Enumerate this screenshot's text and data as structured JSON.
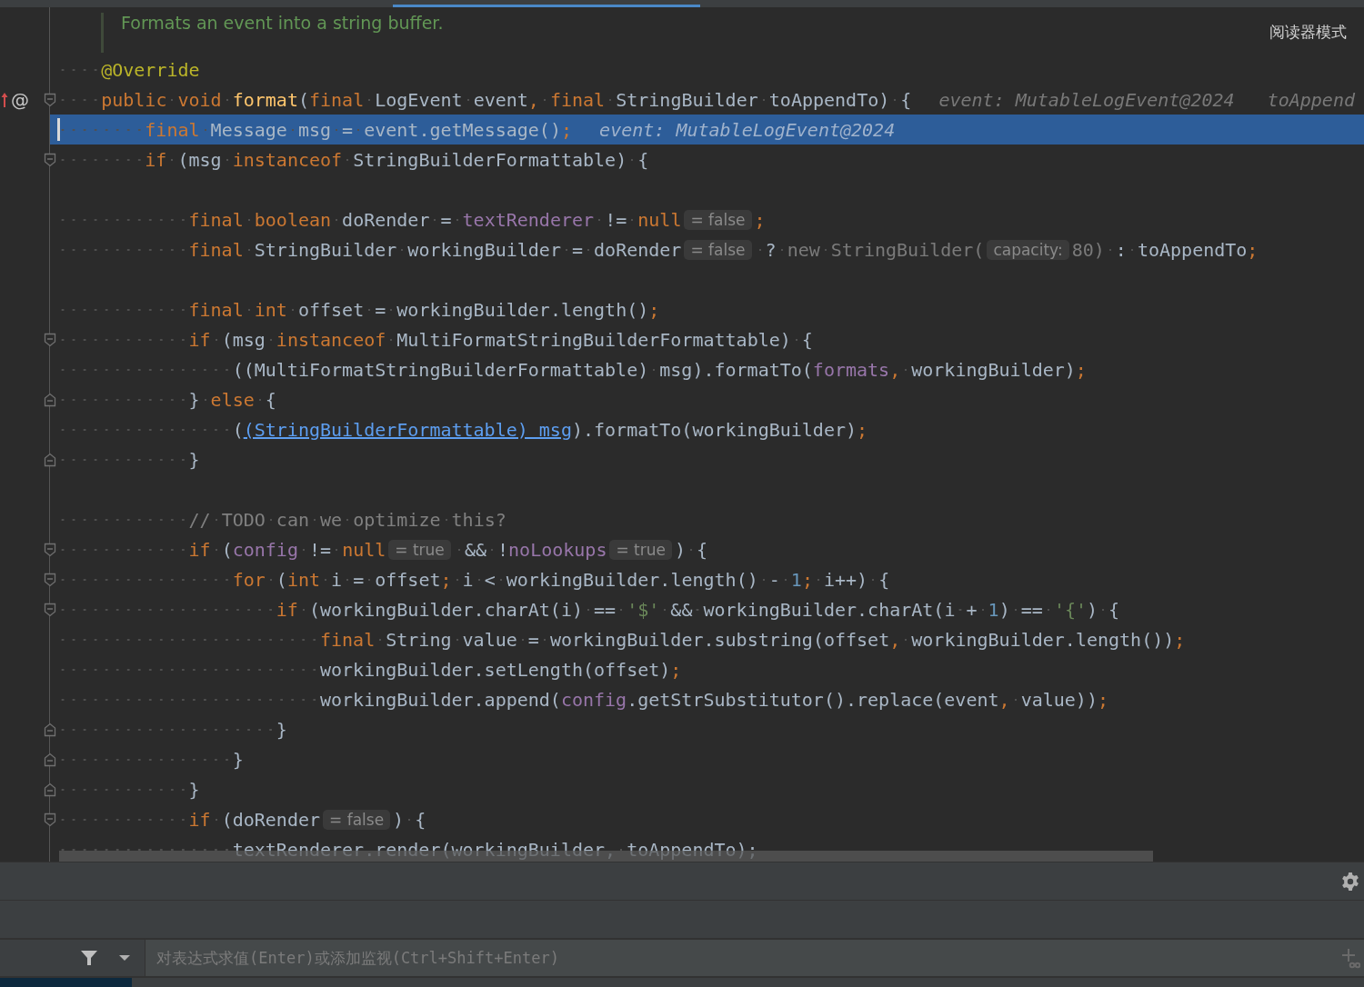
{
  "reader_mode": "阅读器模式",
  "doc_comment": "Formats an event into a string buffer.",
  "lines": [
    {
      "current": false,
      "segments": [
        {
          "kind": "code",
          "tokens": [
            {
              "kind": "annotation",
              "text": "    @Override"
            }
          ]
        }
      ]
    },
    {
      "current": false,
      "marker": "@",
      "fold": {
        "kind": "start"
      },
      "segments": [
        {
          "kind": "code",
          "tokens": [
            {
              "kind": "keyword",
              "text": "    public void "
            },
            {
              "kind": "method",
              "text": "format"
            },
            {
              "kind": "plain",
              "text": "("
            },
            {
              "kind": "keyword",
              "text": "final"
            },
            {
              "kind": "plain",
              "text": " LogEvent event"
            },
            {
              "kind": "keyword",
              "text": ", final"
            },
            {
              "kind": "plain",
              "text": " StringBuilder toAppendTo) {"
            }
          ]
        },
        {
          "kind": "debug",
          "text": "event: MutableLogEvent@2024"
        },
        {
          "kind": "debug",
          "text": "toAppend"
        }
      ]
    },
    {
      "current": true,
      "segments": [
        {
          "kind": "code",
          "tokens": [
            {
              "kind": "keyword",
              "text": "        final"
            },
            {
              "kind": "plain",
              "text": " Message msg = event.getMessage()"
            },
            {
              "kind": "keyword",
              "text": ";"
            }
          ]
        },
        {
          "kind": "debug",
          "text": "event: MutableLogEvent@2024"
        }
      ]
    },
    {
      "current": false,
      "fold": {
        "kind": "start"
      },
      "segments": [
        {
          "kind": "code",
          "tokens": [
            {
              "kind": "keyword",
              "text": "        if"
            },
            {
              "kind": "plain",
              "text": " (msg "
            },
            {
              "kind": "keyword",
              "text": "instanceof"
            },
            {
              "kind": "plain",
              "text": " StringBuilderFormattable) {"
            }
          ]
        }
      ]
    },
    {
      "current": false
    },
    {
      "current": false,
      "segments": [
        {
          "kind": "code",
          "tokens": [
            {
              "kind": "keyword",
              "text": "            final boolean"
            },
            {
              "kind": "plain",
              "text": " doRender = "
            },
            {
              "kind": "field",
              "text": "textRenderer"
            },
            {
              "kind": "plain",
              "text": " != "
            },
            {
              "kind": "keyword",
              "text": "null"
            }
          ]
        },
        {
          "kind": "hint",
          "text": "= false"
        },
        {
          "kind": "code",
          "tokens": [
            {
              "kind": "keyword",
              "text": ";"
            }
          ]
        }
      ]
    },
    {
      "current": false,
      "segments": [
        {
          "kind": "code",
          "tokens": [
            {
              "kind": "keyword",
              "text": "            final"
            },
            {
              "kind": "plain",
              "text": " StringBuilder workingBuilder = doRender"
            }
          ]
        },
        {
          "kind": "hint",
          "text": "= false"
        },
        {
          "kind": "code",
          "tokens": [
            {
              "kind": "plain",
              "text": " ? "
            },
            {
              "kind": "dim",
              "text": "new StringBuilder("
            }
          ]
        },
        {
          "kind": "hint",
          "text": "capacity:"
        },
        {
          "kind": "code",
          "tokens": [
            {
              "kind": "dim",
              "text": "80)"
            },
            {
              "kind": "plain",
              "text": " : toAppendTo"
            },
            {
              "kind": "keyword",
              "text": ";"
            }
          ]
        }
      ]
    },
    {
      "current": false
    },
    {
      "current": false,
      "segments": [
        {
          "kind": "code",
          "tokens": [
            {
              "kind": "keyword",
              "text": "            final int"
            },
            {
              "kind": "plain",
              "text": " offset = workingBuilder.length()"
            },
            {
              "kind": "keyword",
              "text": ";"
            }
          ]
        }
      ]
    },
    {
      "current": false,
      "fold": {
        "kind": "start"
      },
      "segments": [
        {
          "kind": "code",
          "tokens": [
            {
              "kind": "keyword",
              "text": "            if"
            },
            {
              "kind": "plain",
              "text": " (msg "
            },
            {
              "kind": "keyword",
              "text": "instanceof"
            },
            {
              "kind": "plain",
              "text": " MultiFormatStringBuilderFormattable) {"
            }
          ]
        }
      ]
    },
    {
      "current": false,
      "segments": [
        {
          "kind": "code",
          "tokens": [
            {
              "kind": "plain",
              "text": "                ((MultiFormatStringBuilderFormattable) msg).formatTo("
            },
            {
              "kind": "field",
              "text": "formats"
            },
            {
              "kind": "keyword",
              "text": ","
            },
            {
              "kind": "plain",
              "text": " workingBuilder)"
            },
            {
              "kind": "keyword",
              "text": ";"
            }
          ]
        }
      ]
    },
    {
      "current": false,
      "fold": {
        "kind": "end"
      },
      "segments": [
        {
          "kind": "code",
          "tokens": [
            {
              "kind": "plain",
              "text": "            } "
            },
            {
              "kind": "keyword",
              "text": "else"
            },
            {
              "kind": "plain",
              "text": " {"
            }
          ]
        }
      ]
    },
    {
      "current": false,
      "segments": [
        {
          "kind": "code",
          "tokens": [
            {
              "kind": "plain",
              "text": "                ("
            },
            {
              "kind": "link",
              "text": "(StringBuilderFormattable) msg"
            },
            {
              "kind": "plain",
              "text": ").formatTo(workingBuilder)"
            },
            {
              "kind": "keyword",
              "text": ";"
            }
          ]
        }
      ]
    },
    {
      "current": false,
      "fold": {
        "kind": "end"
      },
      "segments": [
        {
          "kind": "code",
          "tokens": [
            {
              "kind": "plain",
              "text": "            }"
            }
          ]
        }
      ]
    },
    {
      "current": false
    },
    {
      "current": false,
      "segments": [
        {
          "kind": "code",
          "tokens": [
            {
              "kind": "comment",
              "text": "            // TODO can we optimize this?"
            }
          ]
        }
      ]
    },
    {
      "current": false,
      "fold": {
        "kind": "start"
      },
      "segments": [
        {
          "kind": "code",
          "tokens": [
            {
              "kind": "keyword",
              "text": "            if"
            },
            {
              "kind": "plain",
              "text": " ("
            },
            {
              "kind": "field",
              "text": "config"
            },
            {
              "kind": "plain",
              "text": " != "
            },
            {
              "kind": "keyword",
              "text": "null"
            }
          ]
        },
        {
          "kind": "hint",
          "text": "= true"
        },
        {
          "kind": "code",
          "tokens": [
            {
              "kind": "plain",
              "text": " && !"
            },
            {
              "kind": "field",
              "text": "noLookups"
            }
          ]
        },
        {
          "kind": "hint",
          "text": "= true"
        },
        {
          "kind": "code",
          "tokens": [
            {
              "kind": "plain",
              "text": ") {"
            }
          ]
        }
      ]
    },
    {
      "current": false,
      "fold": {
        "kind": "start"
      },
      "segments": [
        {
          "kind": "code",
          "tokens": [
            {
              "kind": "keyword",
              "text": "                for"
            },
            {
              "kind": "plain",
              "text": " ("
            },
            {
              "kind": "keyword",
              "text": "int"
            },
            {
              "kind": "plain",
              "text": " i = offset"
            },
            {
              "kind": "keyword",
              "text": ";"
            },
            {
              "kind": "plain",
              "text": " i < workingBuilder.length() - "
            },
            {
              "kind": "number",
              "text": "1"
            },
            {
              "kind": "keyword",
              "text": ";"
            },
            {
              "kind": "plain",
              "text": " i++) {"
            }
          ]
        }
      ]
    },
    {
      "current": false,
      "fold": {
        "kind": "start"
      },
      "segments": [
        {
          "kind": "code",
          "tokens": [
            {
              "kind": "keyword",
              "text": "                    if"
            },
            {
              "kind": "plain",
              "text": " (workingBuilder.charAt(i) == "
            },
            {
              "kind": "string",
              "text": "'$'"
            },
            {
              "kind": "plain",
              "text": " && workingBuilder.charAt(i + "
            },
            {
              "kind": "number",
              "text": "1"
            },
            {
              "kind": "plain",
              "text": ") == "
            },
            {
              "kind": "string",
              "text": "'{'"
            },
            {
              "kind": "plain",
              "text": ") {"
            }
          ]
        }
      ]
    },
    {
      "current": false,
      "segments": [
        {
          "kind": "code",
          "tokens": [
            {
              "kind": "keyword",
              "text": "                        final"
            },
            {
              "kind": "plain",
              "text": " String value = workingBuilder.substring(offset"
            },
            {
              "kind": "keyword",
              "text": ","
            },
            {
              "kind": "plain",
              "text": " workingBuilder.length())"
            },
            {
              "kind": "keyword",
              "text": ";"
            }
          ]
        }
      ]
    },
    {
      "current": false,
      "segments": [
        {
          "kind": "code",
          "tokens": [
            {
              "kind": "plain",
              "text": "                        workingBuilder.setLength(offset)"
            },
            {
              "kind": "keyword",
              "text": ";"
            }
          ]
        }
      ]
    },
    {
      "current": false,
      "segments": [
        {
          "kind": "code",
          "tokens": [
            {
              "kind": "plain",
              "text": "                        workingBuilder.append("
            },
            {
              "kind": "field",
              "text": "config"
            },
            {
              "kind": "plain",
              "text": ".getStrSubstitutor().replace(event"
            },
            {
              "kind": "keyword",
              "text": ","
            },
            {
              "kind": "plain",
              "text": " value))"
            },
            {
              "kind": "keyword",
              "text": ";"
            }
          ]
        }
      ]
    },
    {
      "current": false,
      "fold": {
        "kind": "end"
      },
      "segments": [
        {
          "kind": "code",
          "tokens": [
            {
              "kind": "plain",
              "text": "                    }"
            }
          ]
        }
      ]
    },
    {
      "current": false,
      "fold": {
        "kind": "end"
      },
      "segments": [
        {
          "kind": "code",
          "tokens": [
            {
              "kind": "plain",
              "text": "                }"
            }
          ]
        }
      ]
    },
    {
      "current": false,
      "fold": {
        "kind": "end"
      },
      "segments": [
        {
          "kind": "code",
          "tokens": [
            {
              "kind": "plain",
              "text": "            }"
            }
          ]
        }
      ]
    },
    {
      "current": false,
      "fold": {
        "kind": "start"
      },
      "segments": [
        {
          "kind": "code",
          "tokens": [
            {
              "kind": "keyword",
              "text": "            if"
            },
            {
              "kind": "plain",
              "text": " (doRender"
            }
          ]
        },
        {
          "kind": "hint",
          "text": "= false"
        },
        {
          "kind": "code",
          "tokens": [
            {
              "kind": "plain",
              "text": ") {"
            }
          ]
        }
      ]
    },
    {
      "current": false,
      "segments": [
        {
          "kind": "code",
          "tokens": [
            {
              "kind": "plain",
              "text": "                textRenderer.render(workingBuilder, toAppendTo);"
            }
          ]
        }
      ]
    }
  ],
  "watch_panel": {
    "expression_placeholder": "对表达式求值(Enter)或添加监视(Ctrl+Shift+Enter)"
  }
}
